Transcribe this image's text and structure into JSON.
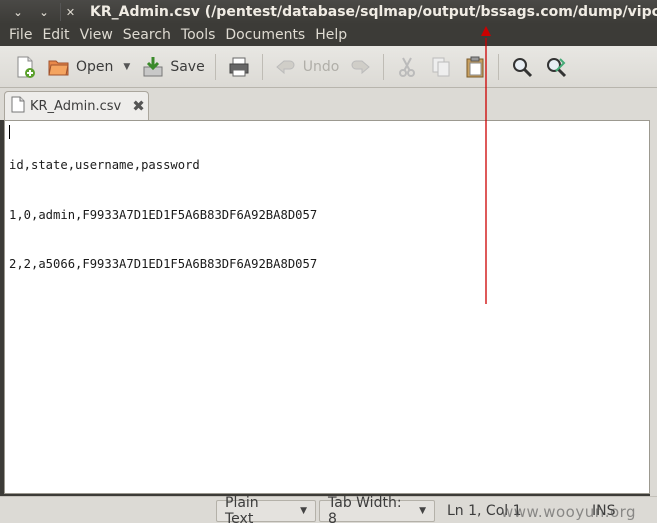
{
  "window": {
    "title": "KR_Admin.csv (/pentest/database/sqlmap/output/bssags.com/dump/vipcp)",
    "controls": [
      "⌄",
      "⌄",
      "✕"
    ]
  },
  "menu": [
    "File",
    "Edit",
    "View",
    "Search",
    "Tools",
    "Documents",
    "Help"
  ],
  "toolbar": {
    "open_label": "Open",
    "save_label": "Save",
    "undo_label": "Undo"
  },
  "tab": {
    "label": "KR_Admin.csv",
    "close": "✖"
  },
  "editor": {
    "lines": [
      "id,state,username,password",
      "1,0,admin,F9933A7D1ED1F5A6B83DF6A92BA8D057",
      "2,2,a5066,F9933A7D1ED1F5A6B83DF6A92BA8D057"
    ]
  },
  "status": {
    "language": "Plain Text",
    "tab_width": "Tab Width:  8",
    "position": "Ln 1, Col 1",
    "mode": "INS"
  },
  "watermark": "www.wooyun.org",
  "colors": {
    "annotation": "#cc0000"
  }
}
